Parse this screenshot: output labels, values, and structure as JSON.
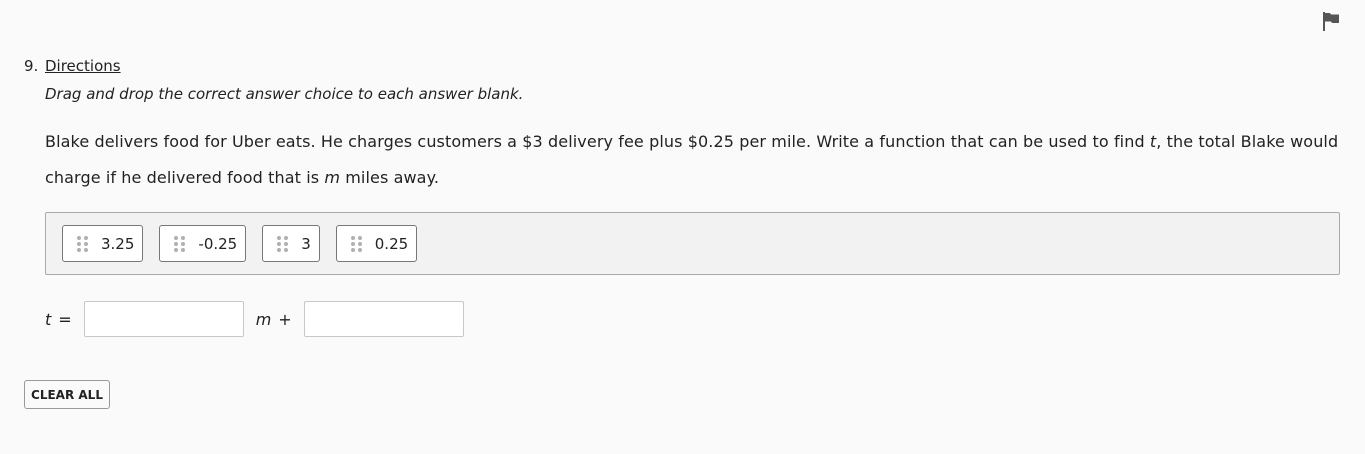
{
  "question": {
    "number": "9.",
    "directions_link": "Directions",
    "directions_text": "Drag and drop the correct answer choice to each answer blank.",
    "stem": {
      "part1": "Blake delivers food for Uber eats. He charges customers a $3 delivery fee plus $0.25 per mile. Write a function that can be used to find ",
      "var_t": "t",
      "part2": ", the total Blake would charge if he delivered food that is ",
      "var_m": "m",
      "part3": " miles away."
    }
  },
  "answer_bank": {
    "choices": [
      {
        "label": "3.25"
      },
      {
        "label": "-0.25"
      },
      {
        "label": "3"
      },
      {
        "label": "0.25"
      }
    ]
  },
  "equation": {
    "lhs_var": "t",
    "equals": "=",
    "mid_var": "m",
    "plus": "+"
  },
  "controls": {
    "clear_all_label": "CLEAR ALL",
    "flag_icon": "flag-icon"
  },
  "colors": {
    "background": "#fafafa",
    "bank_background": "#f2f2f2",
    "flag": "#555555"
  }
}
